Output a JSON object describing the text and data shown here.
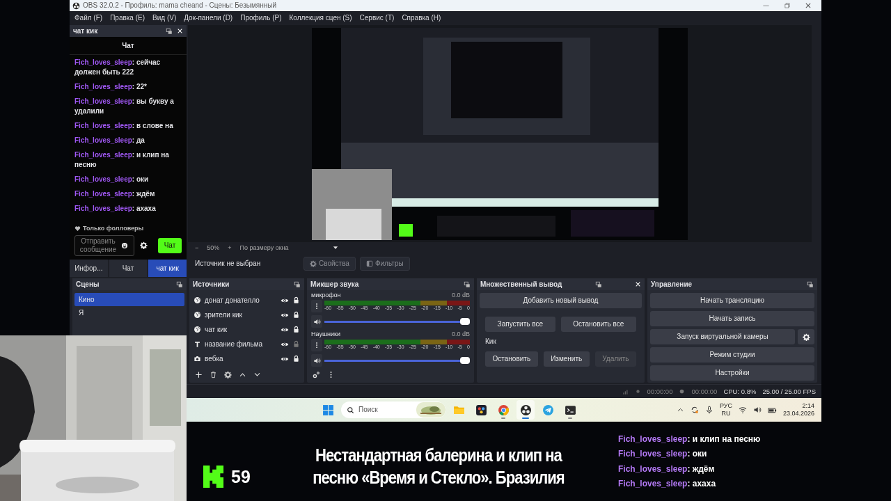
{
  "window": {
    "title": "OBS 32.0.2 - Профиль: mama cheand - Сцены: Безымянный"
  },
  "menu": [
    "Файл (F)",
    "Правка (E)",
    "Вид (V)",
    "Док-панели (D)",
    "Профиль (P)",
    "Коллекция сцен (S)",
    "Сервис (T)",
    "Справка (H)"
  ],
  "chat_dock": {
    "title": "чат кик",
    "header": "Чат",
    "messages": [
      {
        "user": "Fich_loves_sleep",
        "text": ": сейчас должен быть 222"
      },
      {
        "user": "Fich_loves_sleep",
        "text": ": 22*"
      },
      {
        "user": "Fich_loves_sleep",
        "text": ": вы букву а удалили"
      },
      {
        "user": "Fich_loves_sleep",
        "text": ": в слове на"
      },
      {
        "user": "Fich_loves_sleep",
        "text": ": да"
      },
      {
        "user": "Fich_loves_sleep",
        "text": ": и клип на песню"
      },
      {
        "user": "Fich_loves_sleep",
        "text": ": оки"
      },
      {
        "user": "Fich_loves_sleep",
        "text": ": ждём"
      },
      {
        "user": "Fich_loves_sleep",
        "text": ": ахаха"
      }
    ],
    "followers_only": "Только фолловеры",
    "input": {
      "placeholder": "Отправить сообщение"
    },
    "send_button": "Чат"
  },
  "dock_tabs": [
    {
      "label": "Инфор...",
      "selected": false
    },
    {
      "label": "Чат",
      "selected": false
    },
    {
      "label": "чат кик",
      "selected": true
    }
  ],
  "preview_controls": {
    "zoom_out": "−",
    "zoom": "50%",
    "zoom_in": "+",
    "fit": "По размеру окна"
  },
  "source_toolbar": {
    "status": "Источник не выбран",
    "buttons": [
      {
        "label": "Свойства",
        "kind": "properties",
        "disabled": true
      },
      {
        "label": "Фильтры",
        "kind": "filters",
        "disabled": true
      }
    ]
  },
  "scenes": {
    "title": "Сцены",
    "items": [
      {
        "label": "Кино",
        "selected": true
      },
      {
        "label": "Я",
        "selected": false
      }
    ]
  },
  "sources": {
    "title": "Источники",
    "items": [
      {
        "label": "донат донателло",
        "kind": "browser",
        "visible": true,
        "locked": true
      },
      {
        "label": "зрители кик",
        "kind": "browser",
        "visible": true,
        "locked": true
      },
      {
        "label": "чат кик",
        "kind": "browser",
        "visible": true,
        "locked": true
      },
      {
        "label": "название фильма",
        "kind": "text",
        "visible": true,
        "locked": false
      },
      {
        "label": "вебка",
        "kind": "camera",
        "visible": true,
        "locked": true
      }
    ]
  },
  "mixer": {
    "title": "Микшер звука",
    "channels": [
      {
        "name": "микрофон",
        "reading": "0.0 dB",
        "level": 1,
        "scale": [
          "-60",
          "-55",
          "-50",
          "-45",
          "-40",
          "-35",
          "-30",
          "-25",
          "-20",
          "-15",
          "-10",
          "-5",
          "0"
        ]
      },
      {
        "name": "Наушники",
        "reading": "0.0 dB",
        "level": 1,
        "scale": [
          "-60",
          "-55",
          "-50",
          "-45",
          "-40",
          "-35",
          "-30",
          "-25",
          "-20",
          "-15",
          "-10",
          "-5",
          "0"
        ]
      }
    ]
  },
  "multi_output": {
    "title": "Множественный вывод",
    "add_button": "Добавить новый вывод",
    "start_all": "Запустить все",
    "stop_all": "Остановить все",
    "outputs": [
      {
        "name": "Кик",
        "buttons": [
          {
            "label": "Остановить",
            "disabled": false
          },
          {
            "label": "Изменить",
            "disabled": false
          },
          {
            "label": "Удалить",
            "disabled": true
          }
        ]
      }
    ]
  },
  "controls": {
    "title": "Управление",
    "buttons": [
      "Начать трансляцию",
      "Начать запись",
      "Запуск виртуальной камеры",
      "Режим студии",
      "Настройки"
    ]
  },
  "status_bar": {
    "stream_time": "00:00:00",
    "record_time": "00:00:00",
    "cpu": "CPU: 0.8%",
    "fps": "25.00 / 25.00 FPS"
  },
  "taskbar": {
    "search": {
      "placeholder": "Поиск"
    },
    "apps": [
      {
        "kind": "folder",
        "running": false,
        "selected": false
      },
      {
        "kind": "editor",
        "running": false,
        "selected": false
      },
      {
        "kind": "browser",
        "running": true,
        "selected": false
      },
      {
        "kind": "recorder",
        "running": true,
        "selected": true
      },
      {
        "kind": "messenger",
        "running": false,
        "selected": false
      },
      {
        "kind": "terminal",
        "running": true,
        "selected": false
      }
    ],
    "language": [
      "РУС",
      "RU"
    ],
    "time": "2:14",
    "date": "23.04.2026"
  },
  "overlay": {
    "viewers": "59",
    "title_lines": [
      "Нестандартная балерина и клип на",
      "песню «Время и Стекло». Бразилия"
    ],
    "chat": [
      {
        "user": "Fich_loves_sleep",
        "text": ": и клип на песню"
      },
      {
        "user": "Fich_loves_sleep",
        "text": ": оки"
      },
      {
        "user": "Fich_loves_sleep",
        "text": ": ждём"
      },
      {
        "user": "Fich_loves_sleep",
        "text": ": ахаха"
      }
    ]
  }
}
